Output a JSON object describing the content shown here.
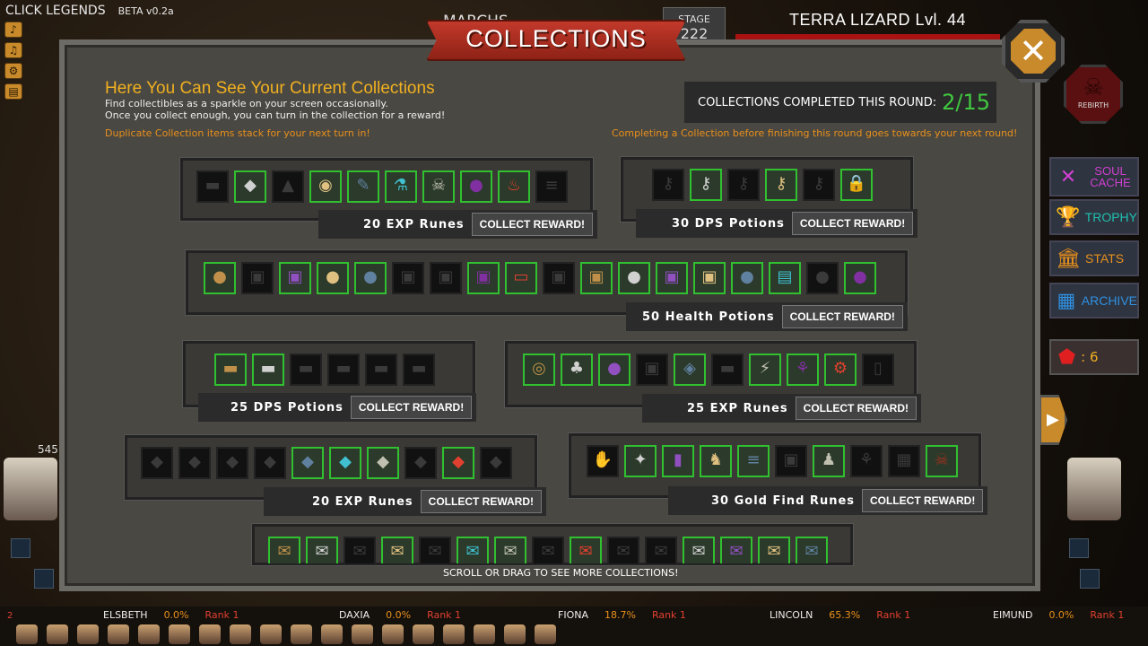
{
  "topbar": {
    "game_title": "CLICK LEGENDS",
    "beta": "BETA v0.2a",
    "march": "MARCHS",
    "stage_label": "STAGE",
    "stage_value": "222"
  },
  "enemy": {
    "name": "TERRA LIZARD Lvl. 44"
  },
  "side_icons": [
    "speaker-icon",
    "music-icon",
    "gear-icon",
    "save-icon"
  ],
  "panel": {
    "title": "COLLECTIONS",
    "heading": "Here You Can See Your Current Collections",
    "sub1": "Find collectibles as a sparkle on your screen occasionally.",
    "sub2": "Once you collect enough, you can turn in the collection for a reward!",
    "dup_note": "Duplicate Collection items stack for your next turn in!",
    "complete_note": "Completing a Collection before finishing this round goes towards your next round!",
    "completed_label": "COLLECTIONS COMPLETED THIS ROUND:",
    "completed_value": "2/15",
    "scroll_hint": "SCROLL OR DRAG TO SEE MORE COLLECTIONS!",
    "collect_label": "COLLECT REWARD!"
  },
  "collections": [
    {
      "reward": "20 EXP Runes",
      "items": [
        "book",
        "crystal",
        "pyramid",
        "eye",
        "feather",
        "flask",
        "skull-mask",
        "cauldron",
        "potion",
        "scroll"
      ],
      "owned": [
        false,
        true,
        false,
        true,
        true,
        true,
        true,
        true,
        true,
        false
      ]
    },
    {
      "reward": "30 DPS Potions",
      "items": [
        "key",
        "key",
        "key",
        "keys",
        "key",
        "padlock"
      ],
      "owned": [
        false,
        true,
        false,
        true,
        false,
        true
      ]
    },
    {
      "reward": "50 Health Potions",
      "items": [
        "sack",
        "chest",
        "chest",
        "bag",
        "sack",
        "chest",
        "chest",
        "chest",
        "crate",
        "chest",
        "chest",
        "bag",
        "chest",
        "chest",
        "sack",
        "map",
        "sack",
        "pot"
      ],
      "owned": [
        true,
        false,
        true,
        true,
        true,
        false,
        false,
        true,
        true,
        false,
        true,
        true,
        true,
        true,
        true,
        true,
        false,
        true
      ]
    },
    {
      "reward": "25 DPS Potions",
      "items": [
        "book",
        "book",
        "book",
        "book",
        "book",
        "book"
      ],
      "owned": [
        true,
        true,
        false,
        false,
        false,
        false
      ]
    },
    {
      "reward": "25 EXP Runes",
      "items": [
        "disc",
        "club",
        "orb",
        "chest",
        "dice",
        "book",
        "wand",
        "vine",
        "gear",
        "card"
      ],
      "owned": [
        true,
        true,
        true,
        false,
        true,
        false,
        true,
        true,
        true,
        false
      ]
    },
    {
      "reward": "20 EXP Runes",
      "items": [
        "gem",
        "gem",
        "gem",
        "gem",
        "gem",
        "gem",
        "gem",
        "gem",
        "gem",
        "gem"
      ],
      "owned": [
        false,
        false,
        false,
        false,
        true,
        true,
        true,
        false,
        true,
        false
      ]
    },
    {
      "reward": "30 Gold Find Runes",
      "items": [
        "claw",
        "bird",
        "totem",
        "imp",
        "scroll",
        "chest",
        "doll",
        "vine",
        "tablet",
        "skull"
      ],
      "owned": [
        false,
        true,
        true,
        true,
        true,
        false,
        true,
        false,
        false,
        true
      ]
    },
    {
      "reward": "",
      "items": [
        "letter",
        "letter",
        "letter",
        "letter",
        "letter",
        "letter",
        "letter",
        "letter",
        "letter",
        "letter",
        "letter",
        "letter",
        "letter",
        "letter",
        "letter"
      ],
      "owned": [
        true,
        true,
        false,
        true,
        false,
        true,
        true,
        false,
        true,
        false,
        false,
        true,
        true,
        true,
        true
      ]
    }
  ],
  "right_menu": {
    "soul_cache": "SOUL CACHE",
    "trophy": "TROPHY",
    "stats": "STATS",
    "archive": "ARCHIVE",
    "gem_count": ": 6",
    "rebirth": "REBIRTH"
  },
  "left_panel": {
    "number": "545"
  },
  "bottom": {
    "red_num": "2",
    "heroes": [
      {
        "name": "ELSBETH",
        "pct": "0.0%",
        "rank": "Rank 1"
      },
      {
        "name": "DAXIA",
        "pct": "0.0%",
        "rank": "Rank 1"
      },
      {
        "name": "FIONA",
        "pct": "18.7%",
        "rank": "Rank 1"
      },
      {
        "name": "LINCOLN",
        "pct": "65.3%",
        "rank": "Rank 1"
      },
      {
        "name": "EIMUND",
        "pct": "0.0%",
        "rank": "Rank 1"
      }
    ]
  },
  "colors": {
    "accent": "#f0b020",
    "owned_border": "#30c030",
    "orange_note": "#e8901c",
    "completed_value": "#40c840"
  }
}
